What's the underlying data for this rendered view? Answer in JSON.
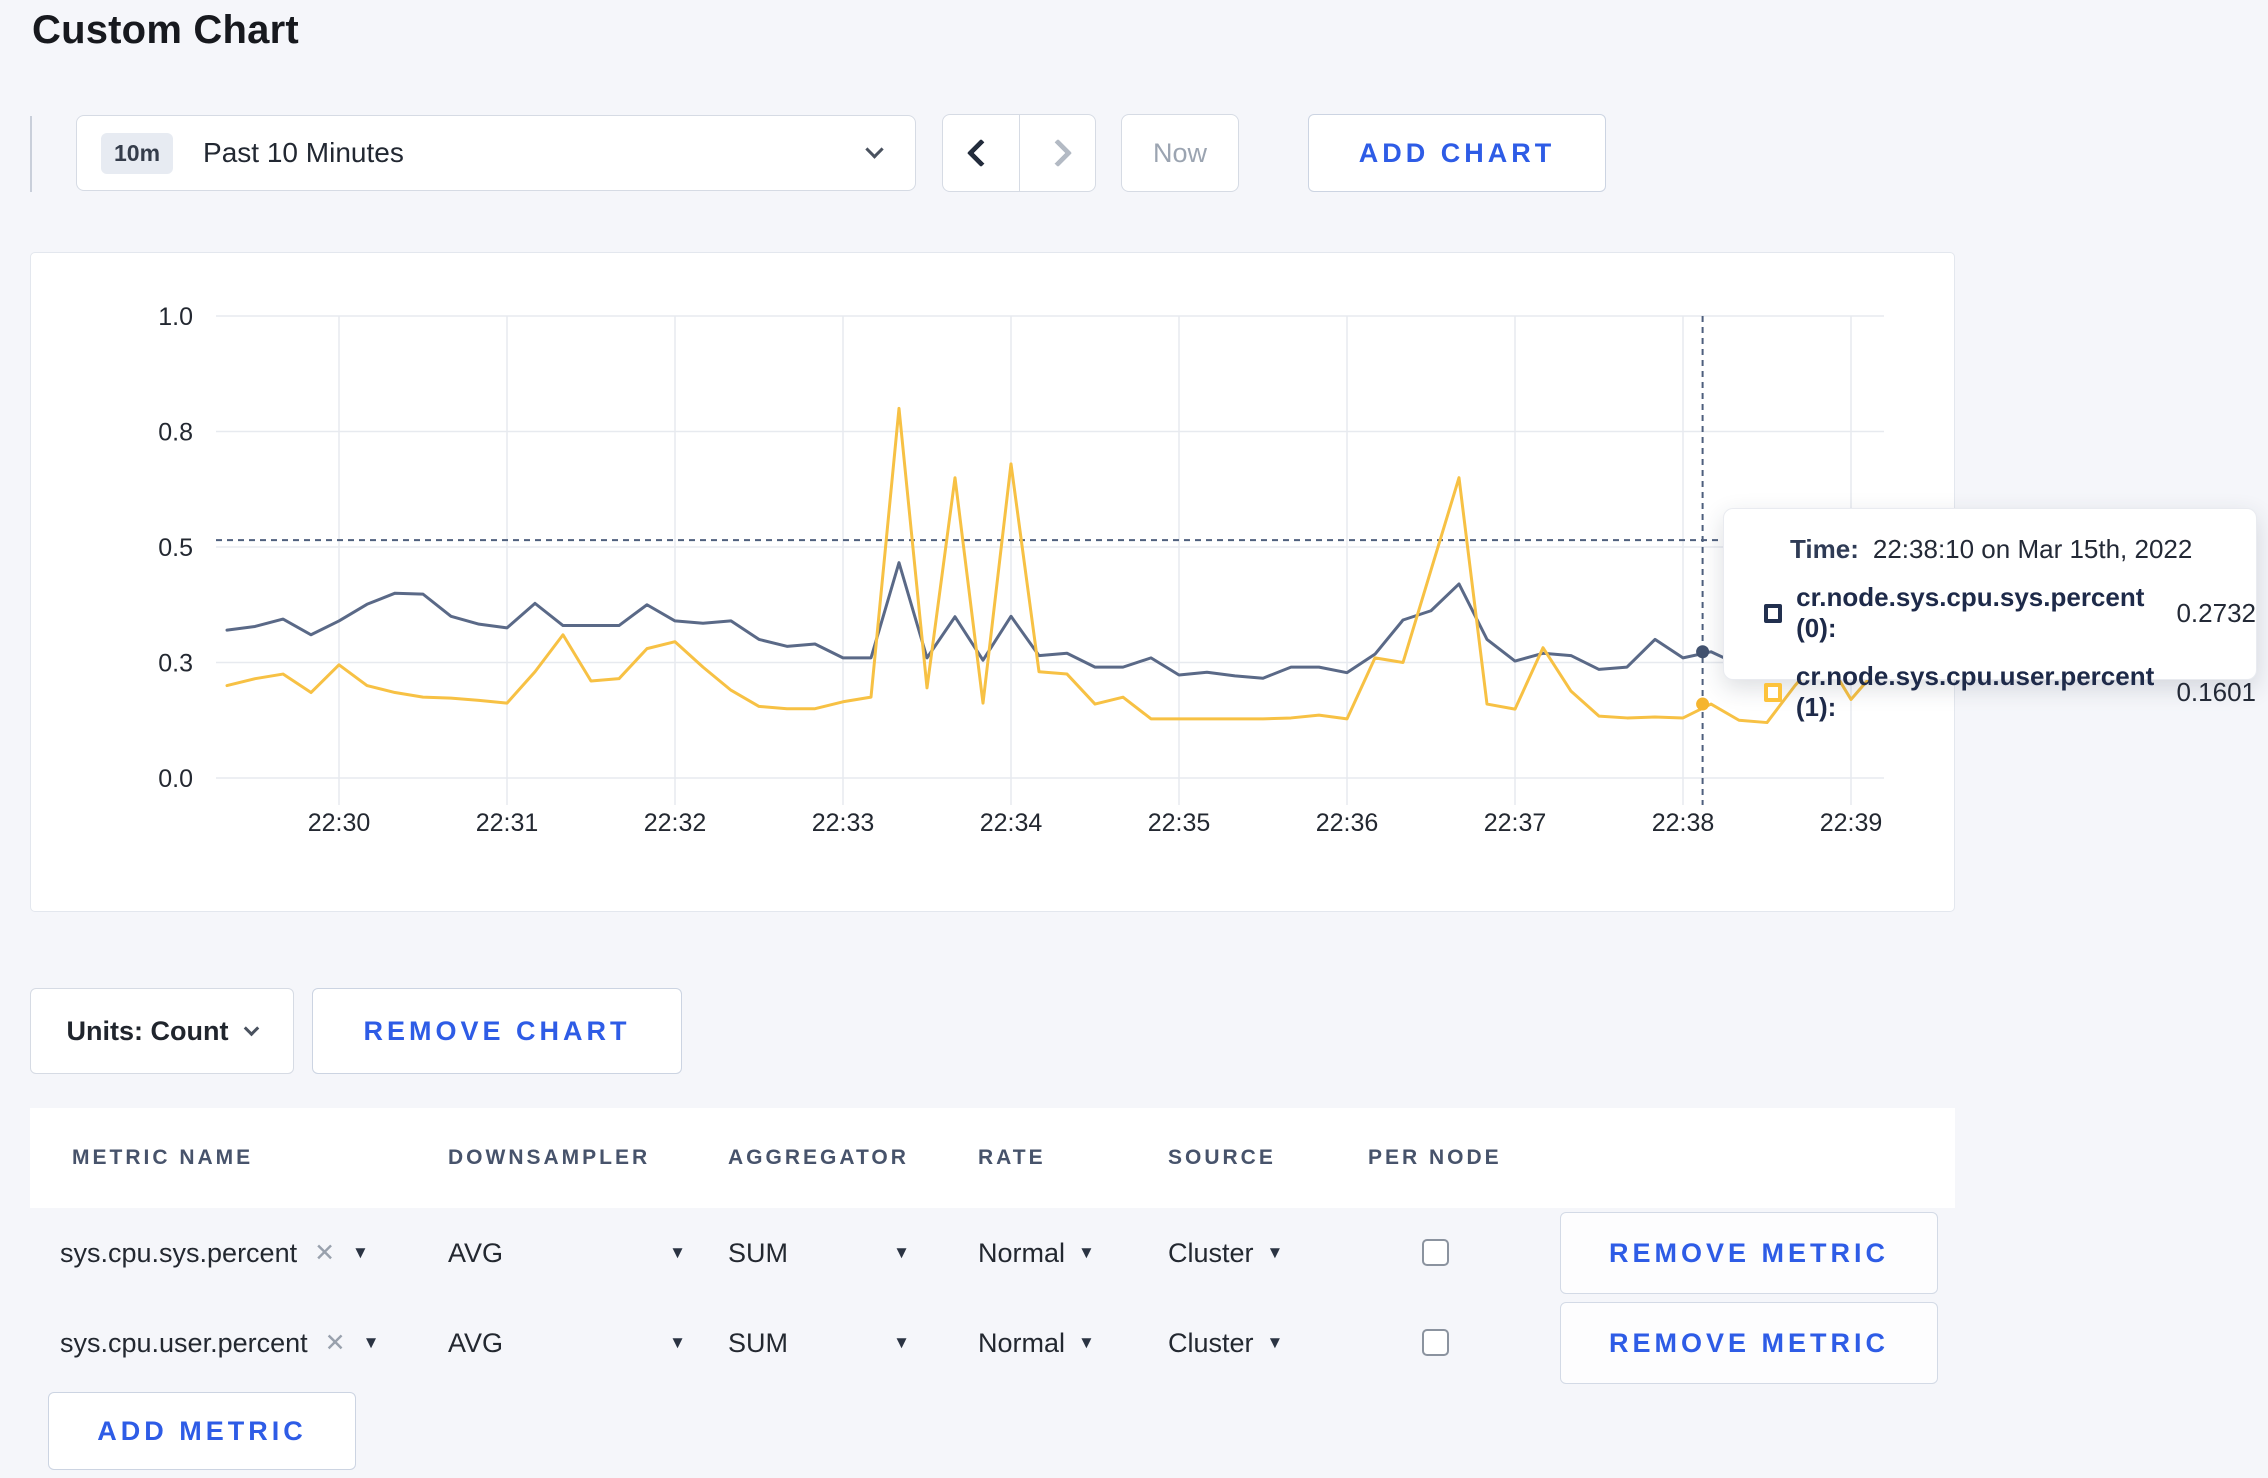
{
  "page": {
    "title": "Custom Chart",
    "background": "#f5f6fa",
    "accent_blue": "#2e5ce6"
  },
  "toolbar": {
    "time_badge": "10m",
    "time_label": "Past 10 Minutes",
    "now_label": "Now",
    "add_chart_label": "ADD CHART"
  },
  "icons": {
    "close": "✕",
    "caret_down": "▼"
  },
  "chart_data": {
    "type": "line",
    "title": "",
    "xlabel": "",
    "ylabel": "",
    "ylim": [
      0,
      1
    ],
    "grid": true,
    "legend_position": "tooltip",
    "x_tick_labels": [
      "22:30",
      "22:31",
      "22:32",
      "22:33",
      "22:34",
      "22:35",
      "22:36",
      "22:37",
      "22:38",
      "22:39"
    ],
    "x_tick_seconds": [
      0,
      60,
      120,
      180,
      240,
      300,
      360,
      420,
      480,
      540
    ],
    "y_tick_values": [
      0,
      0.25,
      0.5,
      0.75,
      1.0
    ],
    "y_tick_labels": [
      "0.0",
      "0.3",
      "0.5",
      "0.8",
      "1.0"
    ],
    "x": [
      -40,
      -30,
      -20,
      -10,
      0,
      10,
      20,
      30,
      40,
      50,
      60,
      70,
      80,
      90,
      100,
      110,
      120,
      130,
      140,
      150,
      160,
      170,
      180,
      190,
      200,
      210,
      220,
      230,
      240,
      250,
      260,
      270,
      280,
      290,
      300,
      310,
      320,
      330,
      340,
      350,
      360,
      370,
      380,
      390,
      400,
      410,
      420,
      430,
      440,
      450,
      460,
      470,
      480,
      490,
      500,
      510,
      520,
      530,
      540,
      550
    ],
    "series": [
      {
        "name": "cr.node.sys.cpu.sys.percent (0)",
        "color": "#5a6987",
        "dot_color": "#42526f",
        "values": [
          0.32,
          0.328,
          0.344,
          0.31,
          0.34,
          0.376,
          0.4,
          0.398,
          0.35,
          0.333,
          0.325,
          0.378,
          0.33,
          0.33,
          0.33,
          0.375,
          0.34,
          0.335,
          0.34,
          0.3,
          0.285,
          0.29,
          0.26,
          0.26,
          0.466,
          0.26,
          0.349,
          0.255,
          0.35,
          0.265,
          0.27,
          0.24,
          0.24,
          0.26,
          0.223,
          0.229,
          0.221,
          0.216,
          0.24,
          0.24,
          0.228,
          0.268,
          0.342,
          0.362,
          0.42,
          0.3,
          0.253,
          0.27,
          0.265,
          0.235,
          0.24,
          0.3,
          0.26,
          0.2732,
          0.245,
          0.27,
          0.295,
          0.305,
          0.3,
          0.295
        ]
      },
      {
        "name": "cr.node.sys.cpu.user.percent (1)",
        "color": "#f7c144",
        "dot_color": "#f5b52f",
        "values": [
          0.2,
          0.215,
          0.225,
          0.185,
          0.245,
          0.2,
          0.185,
          0.175,
          0.173,
          0.168,
          0.162,
          0.23,
          0.31,
          0.21,
          0.215,
          0.28,
          0.295,
          0.24,
          0.19,
          0.155,
          0.15,
          0.15,
          0.165,
          0.175,
          0.8,
          0.195,
          0.65,
          0.162,
          0.68,
          0.23,
          0.225,
          0.16,
          0.175,
          0.128,
          0.128,
          0.128,
          0.128,
          0.128,
          0.13,
          0.136,
          0.128,
          0.26,
          0.25,
          0.45,
          0.65,
          0.16,
          0.149,
          0.282,
          0.188,
          0.134,
          0.13,
          0.132,
          0.13,
          0.1601,
          0.125,
          0.12,
          0.2,
          0.27,
          0.17,
          0.24
        ]
      }
    ],
    "hover": {
      "x_seconds": 487,
      "time": "22:38:10",
      "guideline_value": 0.515,
      "points": [
        0.2732,
        0.1601
      ]
    }
  },
  "tooltip": {
    "time_label": "Time:",
    "time_value": "22:38:10 on Mar 15th, 2022",
    "rows": [
      {
        "name": "cr.node.sys.cpu.sys.percent (0):",
        "value": "0.2732",
        "color": "#22304f"
      },
      {
        "name": "cr.node.sys.cpu.user.percent (1):",
        "value": "0.1601",
        "color": "#fdc33c"
      }
    ]
  },
  "units_row": {
    "units_label": "Units: Count",
    "remove_chart_label": "REMOVE CHART"
  },
  "metrics_table": {
    "headers": [
      "METRIC NAME",
      "DOWNSAMPLER",
      "AGGREGATOR",
      "RATE",
      "SOURCE",
      "PER NODE"
    ],
    "header_offsets": [
      42,
      418,
      698,
      948,
      1138,
      1338
    ],
    "rows": [
      {
        "metric": "sys.cpu.sys.percent",
        "downsampler": "AVG",
        "aggregator": "SUM",
        "rate": "Normal",
        "source": "Cluster",
        "per_node": false,
        "remove_label": "REMOVE METRIC"
      },
      {
        "metric": "sys.cpu.user.percent",
        "downsampler": "AVG",
        "aggregator": "SUM",
        "rate": "Normal",
        "source": "Cluster",
        "per_node": false,
        "remove_label": "REMOVE METRIC"
      }
    ],
    "add_metric_label": "ADD METRIC"
  }
}
